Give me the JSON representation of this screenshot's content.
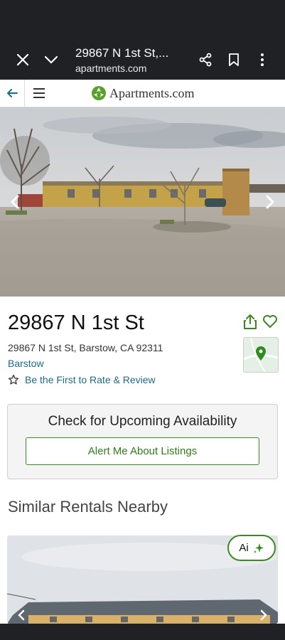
{
  "browser": {
    "title": "29867 N 1st St,...",
    "url": "apartments.com"
  },
  "site": {
    "logo_text": "Apartments.com"
  },
  "property": {
    "title": "29867 N 1st St",
    "address": "29867 N 1st St, Barstow, CA 92311",
    "city": "Barstow",
    "rate_link": "Be the First to Rate & Review"
  },
  "availability": {
    "heading": "Check for Upcoming Availability",
    "button_label": "Alert Me About Listings"
  },
  "similar": {
    "heading": "Similar Rentals Nearby"
  },
  "ai_button": {
    "label": "Ai"
  },
  "colors": {
    "browser_bg": "#202124",
    "brand_green": "#3a8a1f",
    "link_blue": "#1e6b8a"
  },
  "icons": [
    "close-icon",
    "chevron-down-icon",
    "share-icon",
    "bookmark-icon",
    "more-vert-icon",
    "back-arrow-icon",
    "hamburger-icon",
    "star-outline-icon",
    "heart-outline-icon",
    "sparkle-icon"
  ]
}
